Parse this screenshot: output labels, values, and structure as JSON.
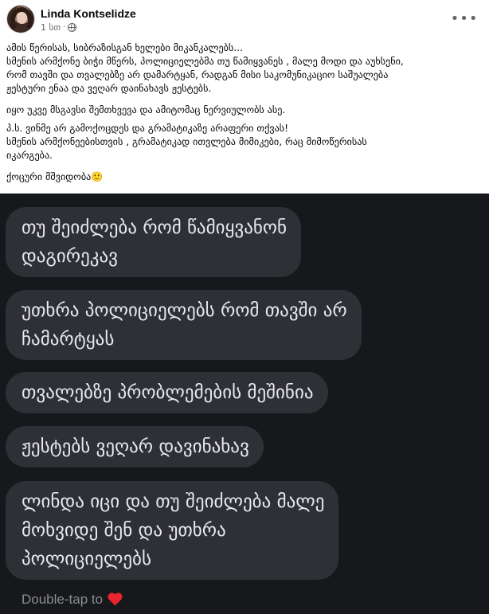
{
  "post": {
    "author": "Linda Kontselidze",
    "time": "1 სთ",
    "separator": "·",
    "privacy_icon": "globe-icon",
    "more_icon": "more-options-icon",
    "more_label": "•••",
    "paragraphs": [
      "ამის წერისას, სიბრაზისგან ხელები მიკანკალებს...\nსმენის არმქონე ბიჭი მწერს, პოლიციელებმა თუ წამიყვანეს , მალე მოდი და აუხსენი,\nრომ თავში და თვალებზე არ დამარტყან, რადგან მისი საკომუნიკაციო საშუალება\nჟესტური ენაა და ვეღარ დაინახავს ჟესტებს.",
      "იყო უკვე მსგავსი შემთხვევა და ამიტომაც ნერვიულობს ასე.",
      "პ.ს.  ვინმე არ გამოქოცდეს და გრამატიკაზე არაფერი თქვას!\nსმენის არმქონეებისთვის , გრამატიკად ითვლება მიმიკები, რაც მიმოწერისას\nიკარგება.",
      "ქოცური მშვიდობა🙂"
    ]
  },
  "screenshot": {
    "messages": [
      "თუ შეიძლება რომ წამიყვანონ\nდაგირეკავ",
      "უთხრა პოლიციელებს რომ თავში არ\nჩამარტყას",
      "თვალებზე პრობლემების მეშინია",
      "ჟესტებს ვეღარ დავინახავ",
      "ლინდა იცი და თუ შეიძლება მალე\nმოხვიდე შენ და უთხრა\nპოლიციელებს"
    ],
    "footer_text": "Double-tap to",
    "footer_icon": "heart-icon",
    "colors": {
      "background": "#17181c",
      "bubble": "#2f3036",
      "bubble_text": "#e9eaee",
      "heart": "#e8242e"
    }
  }
}
